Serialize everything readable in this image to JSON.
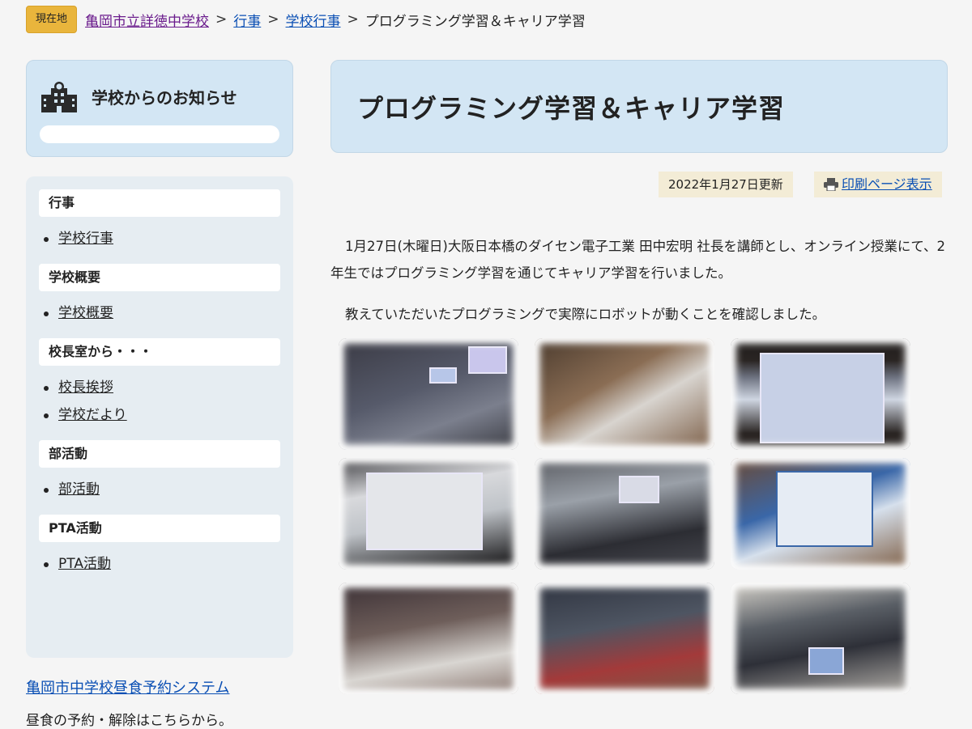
{
  "breadcrumb": {
    "badge": "現在地",
    "items": [
      "亀岡市立詳徳中学校",
      "行事",
      "学校行事"
    ],
    "separator": ">",
    "current": "プログラミング学習＆キャリア学習"
  },
  "sidebar": {
    "notice_title": "学校からのお知らせ",
    "sections": [
      {
        "heading": "行事",
        "items": [
          "学校行事"
        ]
      },
      {
        "heading": "学校概要",
        "items": [
          "学校概要"
        ]
      },
      {
        "heading": "校長室から・・・",
        "items": [
          "校長挨拶",
          "学校だより"
        ]
      },
      {
        "heading": "部活動",
        "items": [
          "部活動"
        ]
      },
      {
        "heading": "PTA活動",
        "items": [
          "PTA活動"
        ]
      }
    ],
    "lunch_link": "亀岡市中学校昼食予約システム",
    "lunch_note": "昼食の予約・解除はこちらから。"
  },
  "main": {
    "title": "プログラミング学習＆キャリア学習",
    "updated": "2022年1月27日更新",
    "print_label": "印刷ページ表示",
    "paragraphs": [
      "1月27日(木曜日)大阪日本橋のダイセン電子工業 田中宏明 社長を講師とし、オンライン授業にて、2年生ではプログラミング学習を通じてキャリア学習を行いました。",
      "教えていただいたプログラミングで実際にロボットが動くことを確認しました。"
    ]
  },
  "colors": {
    "panel_blue": "#d3e6f4",
    "menu_bg": "#e6edf2",
    "badge": "#e9b53c",
    "link": "#0a4fb4",
    "visited": "#6a1b8c",
    "update_bg": "#f3ecd6"
  }
}
